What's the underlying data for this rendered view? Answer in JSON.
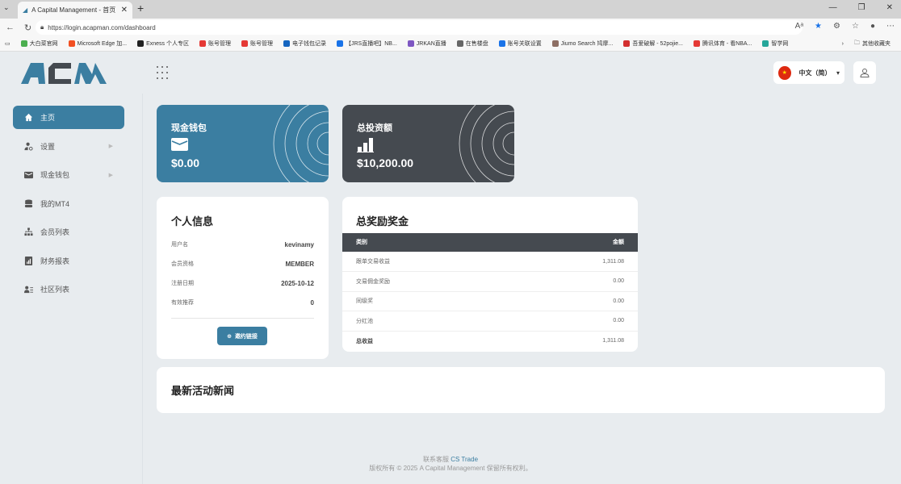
{
  "browser": {
    "tab_title": "A Capital Management - 首页",
    "url": "https://login.acapman.com/dashboard",
    "bookmarks": [
      "大白菜官网",
      "Microsoft Edge 加...",
      "Exness 个人专区",
      "账号管理",
      "账号管理",
      "电子钱包记录",
      "【JRS直播吧】NB...",
      "JRKAN直播",
      "在售楼盘",
      "账号关联设置",
      "Jiumo Search 鸠摩...",
      "吾爱破解 - 52pojie...",
      "腾讯体育 - 看NBA...",
      "智学网"
    ],
    "other_bookmarks": "其他收藏夹"
  },
  "header": {
    "language": "中文（简）"
  },
  "sidebar": {
    "items": [
      {
        "label": "主页"
      },
      {
        "label": "设置"
      },
      {
        "label": "现金钱包"
      },
      {
        "label": "我的MT4"
      },
      {
        "label": "会员列表"
      },
      {
        "label": "财务报表"
      },
      {
        "label": "社区列表"
      }
    ]
  },
  "cash_wallet": {
    "title": "现金钱包",
    "value": "$0.00"
  },
  "total_investment": {
    "title": "总投资额",
    "value": "$10,200.00"
  },
  "profile": {
    "title": "个人信息",
    "rows": [
      {
        "label": "用户名",
        "value": "kevinamy"
      },
      {
        "label": "会员资格",
        "value": "MEMBER"
      },
      {
        "label": "注册日期",
        "value": "2025-10-12"
      },
      {
        "label": "有效推荐",
        "value": "0"
      }
    ],
    "invite_button": "邀约链接"
  },
  "bonus": {
    "title": "总奖励奖金",
    "headers": [
      "类别",
      "金额"
    ],
    "rows": [
      {
        "category": "跟单交易收益",
        "amount": "1,311.08"
      },
      {
        "category": "交易佣金奖励",
        "amount": "0.00"
      },
      {
        "category": "同级奖",
        "amount": "0.00"
      },
      {
        "category": "分红池",
        "amount": "0.00"
      },
      {
        "category": "总收益",
        "amount": "1,311.08"
      }
    ]
  },
  "news": {
    "title": "最新活动新闻"
  },
  "footer": {
    "contact_label": "联系客服",
    "contact_link": "CS Trade",
    "copyright": "版权所有 © 2025 A Capital Management 保留所有权利。"
  }
}
